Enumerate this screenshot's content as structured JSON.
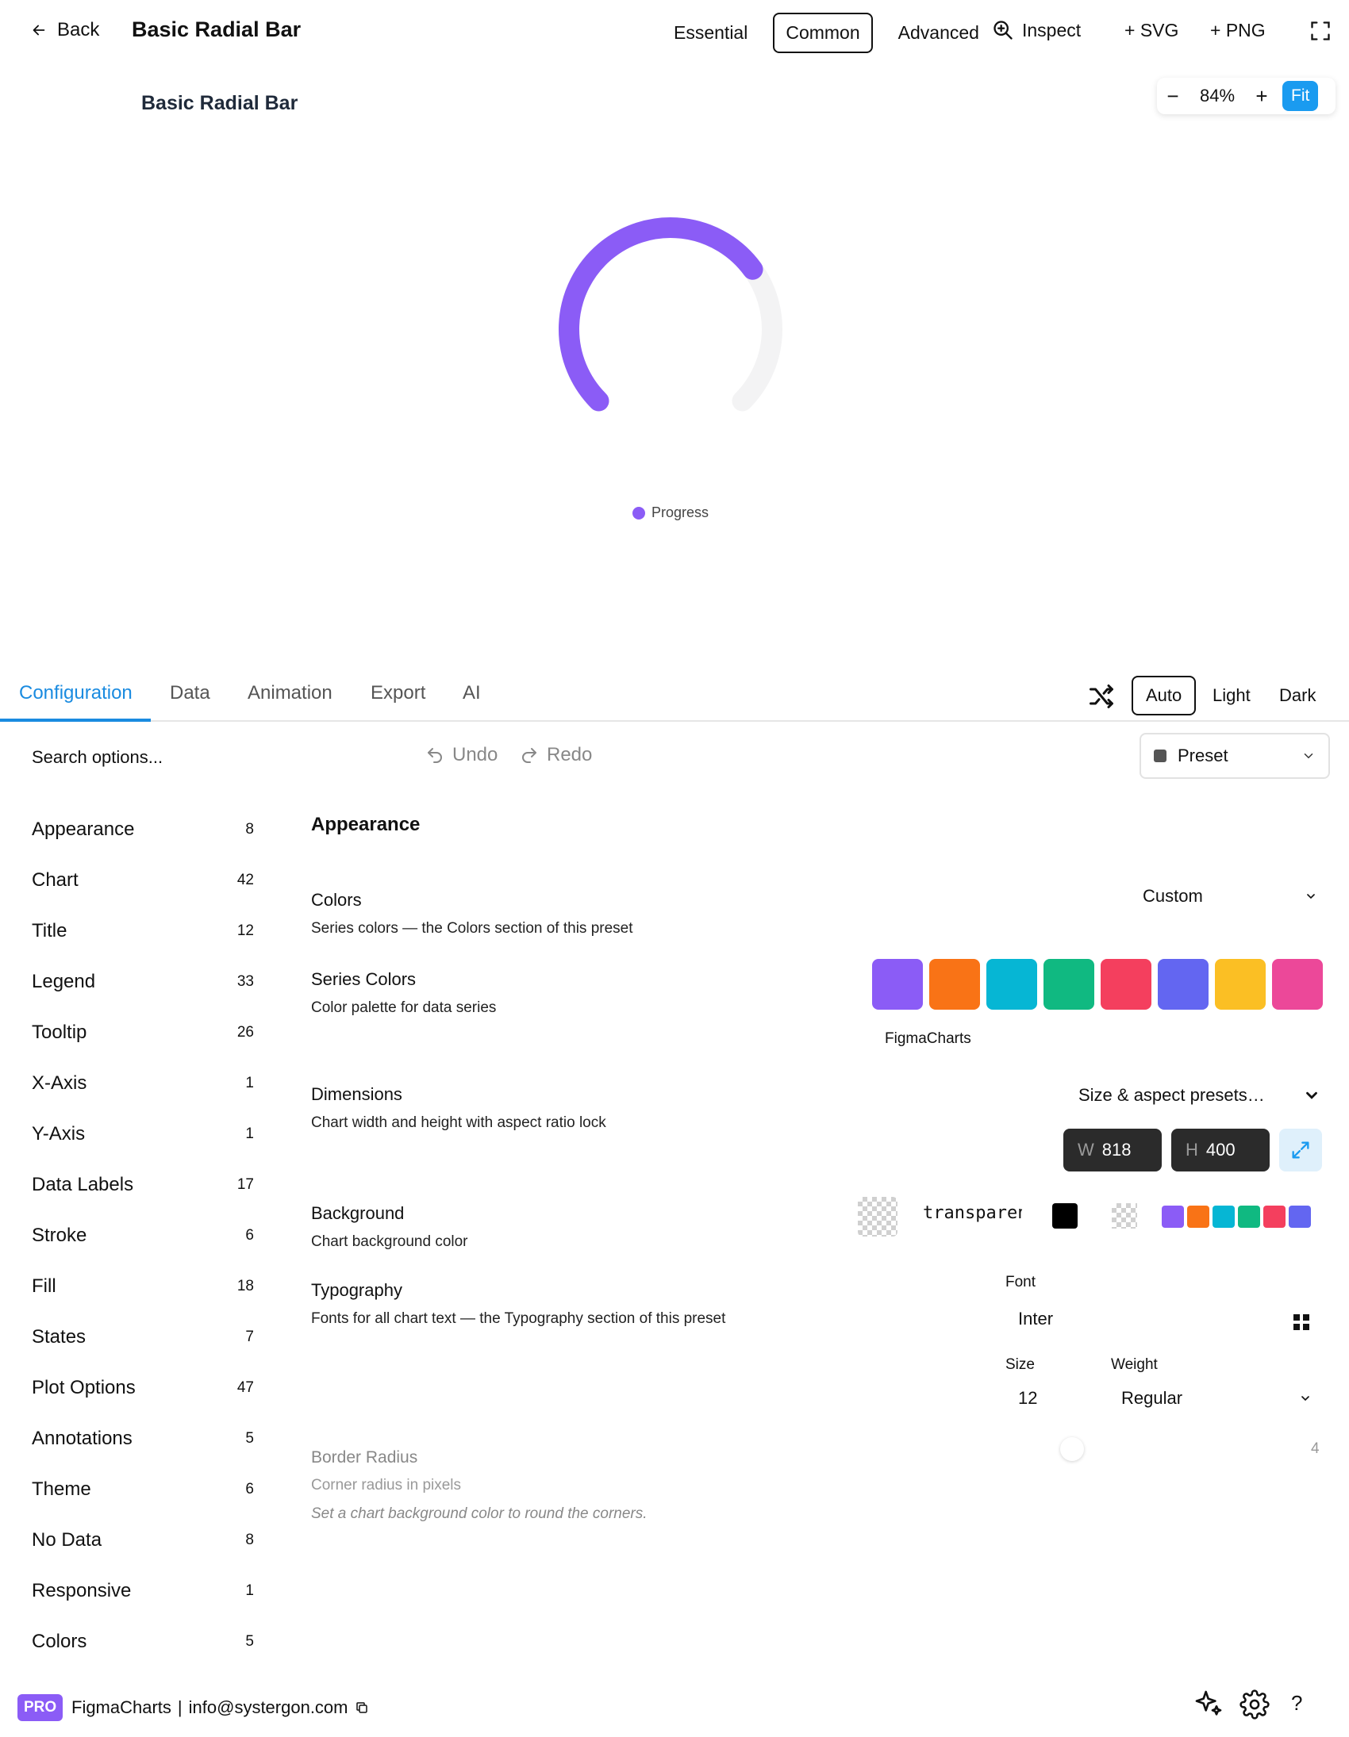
{
  "header": {
    "back_label": "Back",
    "title": "Basic Radial Bar",
    "modes": [
      "Essential",
      "Common",
      "Advanced"
    ],
    "active_mode": "Common",
    "inspect_label": "Inspect",
    "svg_label": "+ SVG",
    "png_label": "+ PNG"
  },
  "canvas": {
    "zoom_out": "−",
    "zoom_value": "84%",
    "zoom_in": "+",
    "fit_label": "Fit"
  },
  "chart_data": {
    "type": "radialBar",
    "title": "Basic Radial Bar",
    "series": [
      {
        "name": "Progress",
        "value": 70,
        "color": "#8b5cf6"
      }
    ],
    "track_color": "#f3f3f4",
    "range": [
      0,
      100
    ],
    "arc_degrees": 270,
    "legend_position": "bottom"
  },
  "config_tabs": {
    "tabs": [
      "Configuration",
      "Data",
      "Animation",
      "Export",
      "AI"
    ],
    "active": "Configuration",
    "theme_modes": [
      "Auto",
      "Light",
      "Dark"
    ],
    "active_theme": "Auto"
  },
  "toolbar": {
    "search_placeholder": "Search options...",
    "undo_label": "Undo",
    "redo_label": "Redo",
    "preset_label": "Preset"
  },
  "sidebar": {
    "items": [
      {
        "label": "Appearance",
        "count": "8"
      },
      {
        "label": "Chart",
        "count": "42"
      },
      {
        "label": "Title",
        "count": "12"
      },
      {
        "label": "Legend",
        "count": "33"
      },
      {
        "label": "Tooltip",
        "count": "26"
      },
      {
        "label": "X-Axis",
        "count": "1"
      },
      {
        "label": "Y-Axis",
        "count": "1"
      },
      {
        "label": "Data Labels",
        "count": "17"
      },
      {
        "label": "Stroke",
        "count": "6"
      },
      {
        "label": "Fill",
        "count": "18"
      },
      {
        "label": "States",
        "count": "7"
      },
      {
        "label": "Plot Options",
        "count": "47"
      },
      {
        "label": "Annotations",
        "count": "5"
      },
      {
        "label": "Theme",
        "count": "6"
      },
      {
        "label": "No Data",
        "count": "8"
      },
      {
        "label": "Responsive",
        "count": "1"
      },
      {
        "label": "Colors",
        "count": "5"
      }
    ]
  },
  "appearance": {
    "section_title": "Appearance",
    "colors": {
      "title": "Colors",
      "desc": "Series colors — the Colors section of this preset",
      "value": "Custom"
    },
    "series_colors": {
      "title": "Series Colors",
      "desc": "Color palette for data series",
      "palette": [
        "#8b5cf6",
        "#f97316",
        "#06b6d4",
        "#10b981",
        "#f43f5e",
        "#6366f1",
        "#fbbf24",
        "#ec4899"
      ],
      "palette_name": "FigmaCharts"
    },
    "dimensions": {
      "title": "Dimensions",
      "desc": "Chart width and height with aspect ratio lock",
      "preset_label": "Size & aspect presets…",
      "width_prefix": "W",
      "width": "818",
      "height_prefix": "H",
      "height": "400"
    },
    "background": {
      "title": "Background",
      "desc": "Chart background color",
      "value": "transparent",
      "mini_palette": [
        "#8b5cf6",
        "#f97316",
        "#06b6d4",
        "#10b981",
        "#f43f5e",
        "#6366f1"
      ]
    },
    "typography": {
      "title": "Typography",
      "desc": "Fonts for all chart text — the Typography section of this preset",
      "font_label": "Font",
      "font_value": "Inter",
      "size_label": "Size",
      "size_value": "12",
      "weight_label": "Weight",
      "weight_value": "Regular"
    },
    "border_radius": {
      "title": "Border Radius",
      "desc": "Corner radius in pixels",
      "note": "Set a chart background color to round the corners.",
      "value": "4"
    }
  },
  "footer": {
    "badge": "PRO",
    "brand": "FigmaCharts",
    "separator": "|",
    "email": "info@systergon.com",
    "help": "?"
  }
}
